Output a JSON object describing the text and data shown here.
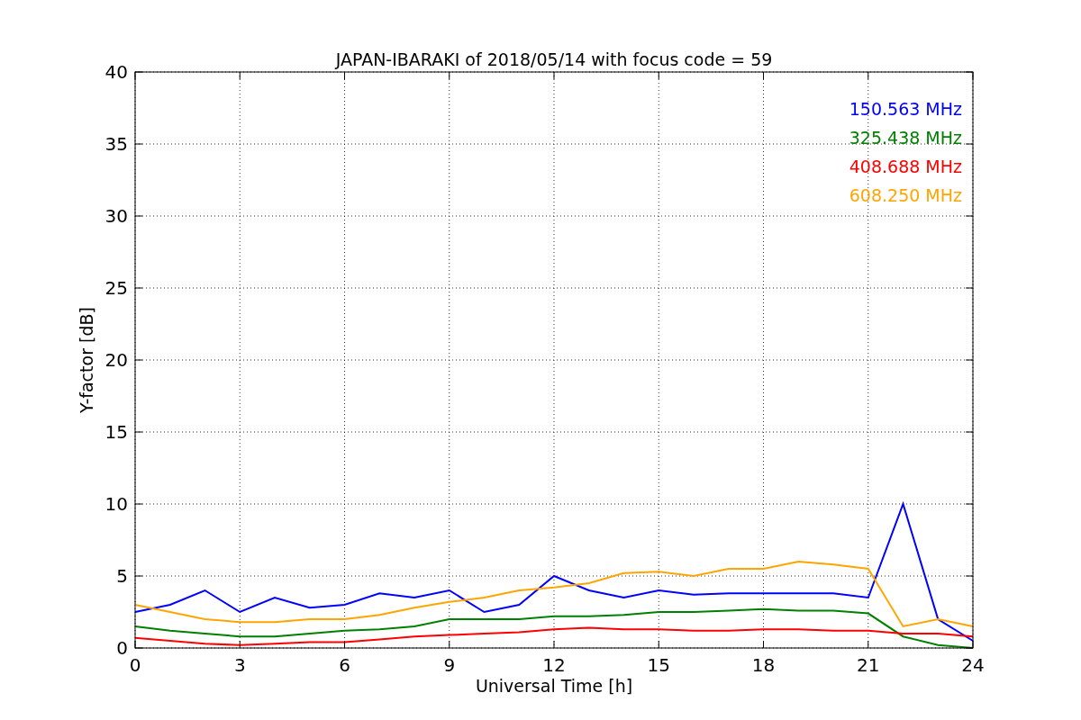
{
  "chart_data": {
    "type": "line",
    "title": "JAPAN-IBARAKI of 2018/05/14 with focus code = 59",
    "xlabel": "Universal Time [h]",
    "ylabel": "Y-factor [dB]",
    "x": [
      0,
      1,
      2,
      3,
      4,
      5,
      6,
      7,
      8,
      9,
      10,
      11,
      12,
      13,
      14,
      15,
      16,
      17,
      18,
      19,
      20,
      21,
      22,
      23,
      24
    ],
    "series": [
      {
        "name": "150.563 MHz",
        "color": "#0000ff",
        "values": [
          2.5,
          3,
          4,
          2.5,
          3.5,
          2.8,
          3,
          3.8,
          3.5,
          4,
          2.5,
          3,
          5,
          4,
          3.5,
          4,
          3.7,
          3.8,
          3.8,
          3.8,
          3.8,
          3.5,
          10,
          2,
          0.5
        ]
      },
      {
        "name": "325.438 MHz",
        "color": "#008000",
        "values": [
          1.5,
          1.2,
          1,
          0.8,
          0.8,
          1,
          1.2,
          1.3,
          1.5,
          2,
          2,
          2,
          2.2,
          2.2,
          2.3,
          2.5,
          2.5,
          2.6,
          2.7,
          2.6,
          2.6,
          2.4,
          0.8,
          0.2,
          0
        ]
      },
      {
        "name": "408.688 MHz",
        "color": "#ff0000",
        "values": [
          0.7,
          0.5,
          0.3,
          0.2,
          0.3,
          0.4,
          0.4,
          0.6,
          0.8,
          0.9,
          1,
          1.1,
          1.3,
          1.4,
          1.3,
          1.3,
          1.2,
          1.2,
          1.3,
          1.3,
          1.2,
          1.2,
          1,
          1,
          0.8
        ]
      },
      {
        "name": "608.250 MHz",
        "color": "#ffa500",
        "values": [
          3,
          2.5,
          2,
          1.8,
          1.8,
          2,
          2,
          2.3,
          2.8,
          3.2,
          3.5,
          4,
          4.2,
          4.5,
          5.2,
          5.3,
          5,
          5.5,
          5.5,
          6,
          5.8,
          5.5,
          1.5,
          2,
          1.5
        ]
      }
    ],
    "xlim": [
      0,
      24
    ],
    "ylim": [
      0,
      40
    ],
    "xticks": [
      0,
      3,
      6,
      9,
      12,
      15,
      18,
      21,
      24
    ],
    "yticks": [
      0,
      5,
      10,
      15,
      20,
      25,
      30,
      35,
      40
    ],
    "grid": true
  }
}
